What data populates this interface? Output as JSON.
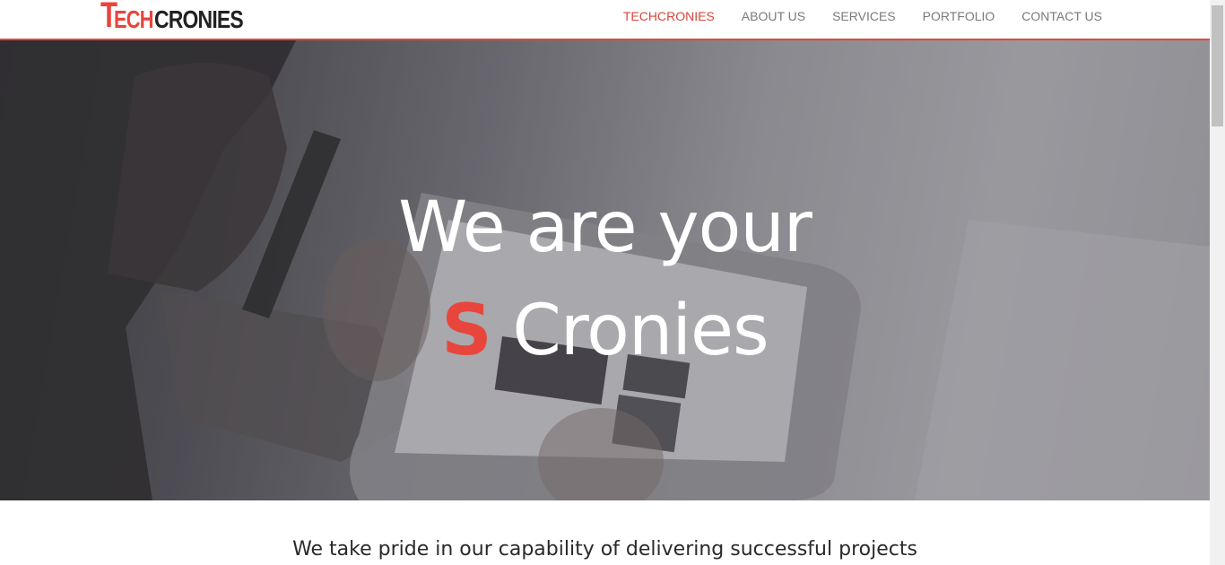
{
  "logo": {
    "part_t": "T",
    "part_ech": "ECH",
    "part_cronies": "CRONIES",
    "accent_color": "#e8453c",
    "dark_color": "#222222"
  },
  "nav": {
    "items": [
      {
        "label": "TECHCRONIES",
        "active": true
      },
      {
        "label": "ABOUT US",
        "active": false
      },
      {
        "label": "SERVICES",
        "active": false
      },
      {
        "label": "PORTFOLIO",
        "active": false
      },
      {
        "label": "CONTACT US",
        "active": false
      }
    ]
  },
  "hero": {
    "line1": "We are your",
    "accent": "S",
    "line2_rest": " Cronies",
    "accent_color": "#e8453c"
  },
  "tagline": "We take pride in our capability of delivering successful projects"
}
